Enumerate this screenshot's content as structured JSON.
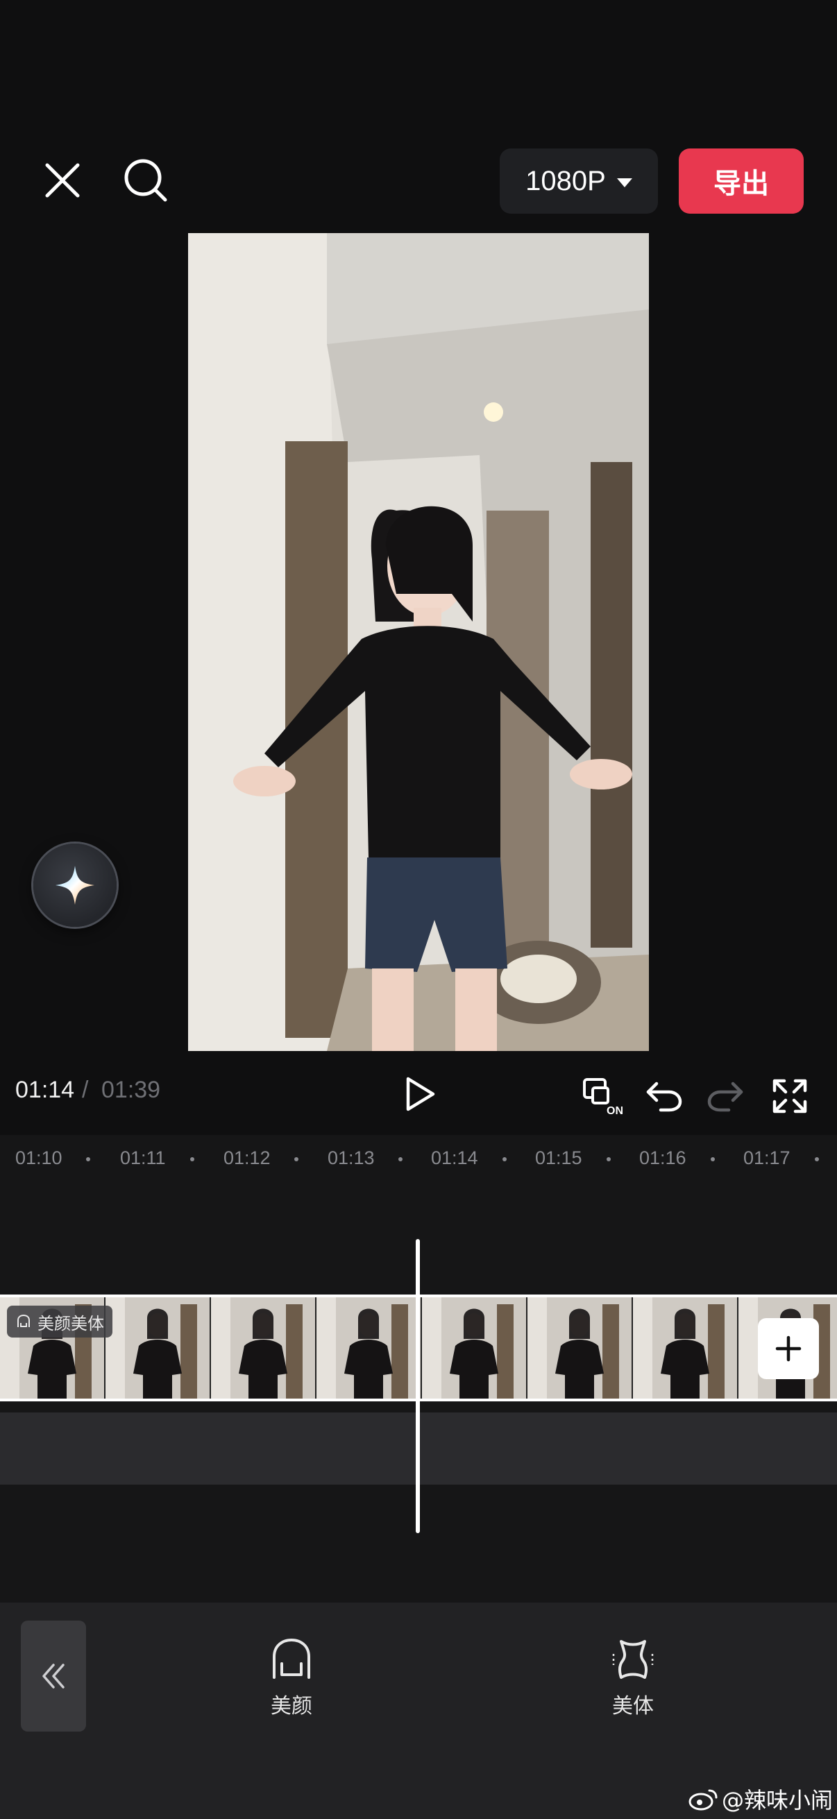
{
  "header": {
    "resolution_label": "1080P",
    "export_label": "导出"
  },
  "playback": {
    "current_time": "01:14",
    "separator": "/",
    "total_time": "01:39"
  },
  "timeline": {
    "ruler_labels": [
      "01:10",
      "01:11",
      "01:12",
      "01:13",
      "01:14",
      "01:15",
      "01:16",
      "01:17"
    ],
    "clip_badge": "美颜美体"
  },
  "toolbar": {
    "items": [
      {
        "label": "美颜",
        "icon": "face-beauty-icon"
      },
      {
        "label": "美体",
        "icon": "body-shape-icon"
      }
    ]
  },
  "watermark": "@辣味小闹",
  "colors": {
    "accent": "#e8384f",
    "background": "#0f0f10"
  }
}
